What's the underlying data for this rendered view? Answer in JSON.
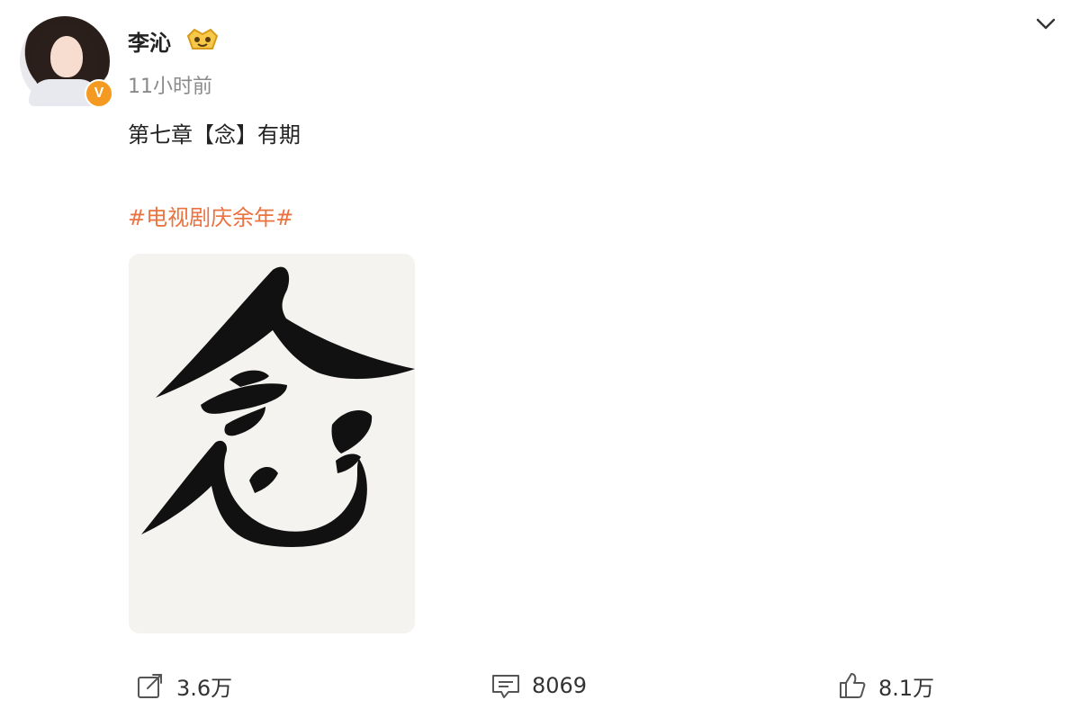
{
  "post": {
    "author": "李沁",
    "verified_mark": "V",
    "timestamp": "11小时前",
    "text": "第七章【念】有期",
    "hashtag": "#电视剧庆余年#",
    "image_glyph": "念"
  },
  "actions": {
    "repost_count": "3.6万",
    "comment_count": "8069",
    "like_count": "8.1万"
  },
  "colors": {
    "hashtag": "#eb7340",
    "verified": "#f49a20",
    "timestamp": "#8a8a8a"
  },
  "icons": [
    "chevron-down-icon",
    "vip-badge-icon",
    "repost-icon",
    "comment-icon",
    "like-icon"
  ]
}
